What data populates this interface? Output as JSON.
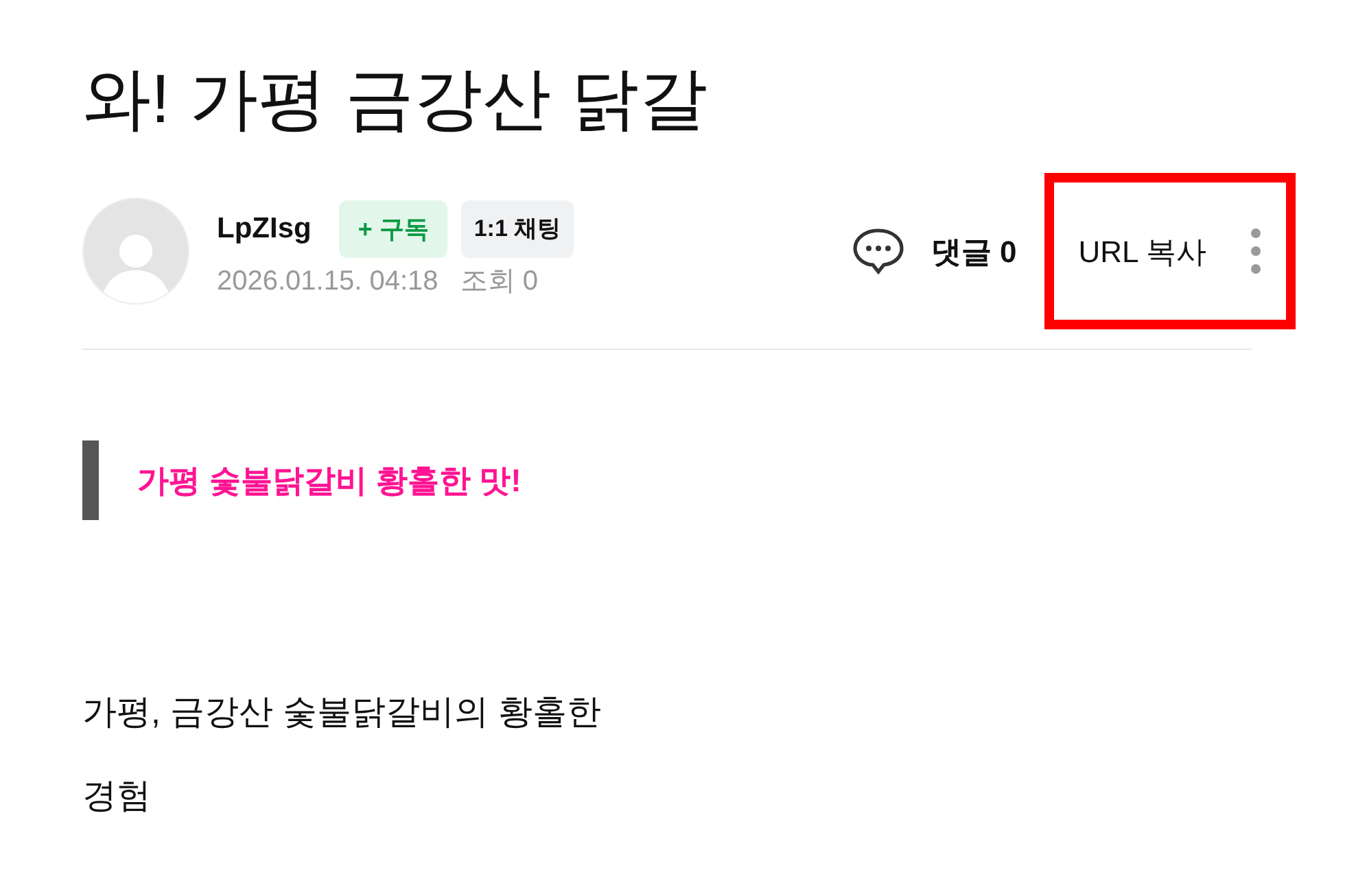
{
  "post": {
    "title": "와! 가평 금강산 닭갈",
    "author": {
      "name": "LpZIsg",
      "subscribe": "+ 구독",
      "chat": "1:1 채팅",
      "date": "2026.01.15. 04:18",
      "views": "조회 0"
    },
    "actions": {
      "comments": "댓글 0",
      "url_copy": "URL 복사",
      "highlighted": true
    },
    "quote": "가평 숯불닭갈비 황홀한 맛!",
    "body": [
      "가평, 금강산 숯불닭갈비의 황홀한",
      "경험"
    ]
  }
}
